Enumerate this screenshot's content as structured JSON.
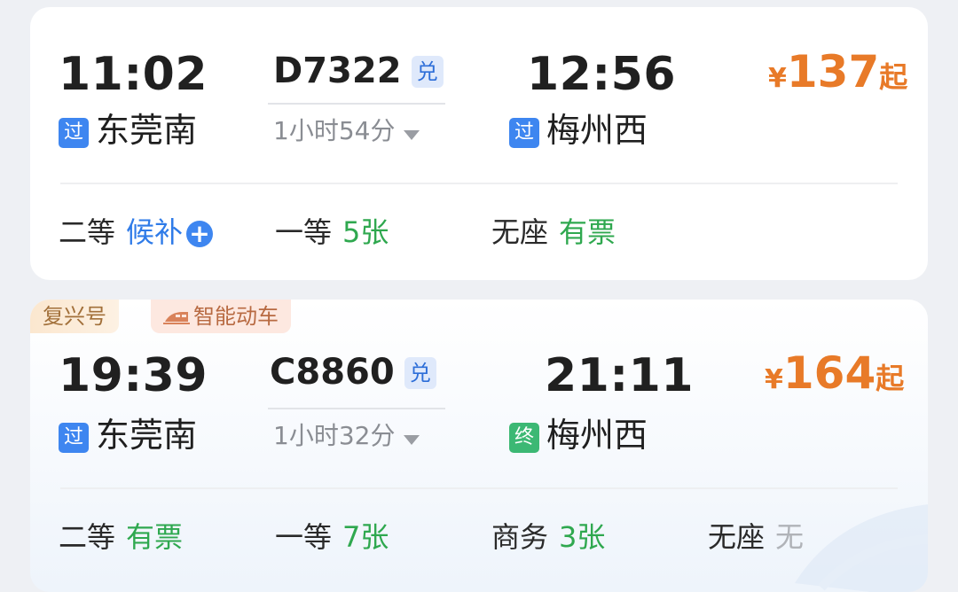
{
  "trains": [
    {
      "depart_time": "11:02",
      "train_no": "D7322",
      "exchange_badge": "兑",
      "arrive_time": "12:56",
      "from_badge": "过",
      "from_station": "东莞南",
      "duration": "1小时54分",
      "to_badge": "过",
      "to_station": "梅州西",
      "price_currency": "¥",
      "price_value": "137",
      "price_suffix": "起",
      "seats": [
        {
          "class": "二等",
          "status": "候补"
        },
        {
          "class": "一等",
          "status": "5张"
        },
        {
          "class": "无座",
          "status": "有票"
        }
      ]
    },
    {
      "tags": {
        "fuxing": "复兴号",
        "smart": "智能动车"
      },
      "depart_time": "19:39",
      "train_no": "C8860",
      "exchange_badge": "兑",
      "arrive_time": "21:11",
      "from_badge": "过",
      "from_station": "东莞南",
      "duration": "1小时32分",
      "to_badge": "终",
      "to_station": "梅州西",
      "price_currency": "¥",
      "price_value": "164",
      "price_suffix": "起",
      "seats": [
        {
          "class": "二等",
          "status": "有票"
        },
        {
          "class": "一等",
          "status": "7张"
        },
        {
          "class": "商务",
          "status": "3张"
        },
        {
          "class": "无座",
          "status": "无"
        }
      ]
    }
  ],
  "colors": {
    "price": "#e87a28",
    "available": "#2fa84f",
    "waitlist": "#2f7be8",
    "unavailable": "#b0b3b8",
    "pass_badge": "#3e86f0",
    "terminal_badge": "#3cb874"
  }
}
